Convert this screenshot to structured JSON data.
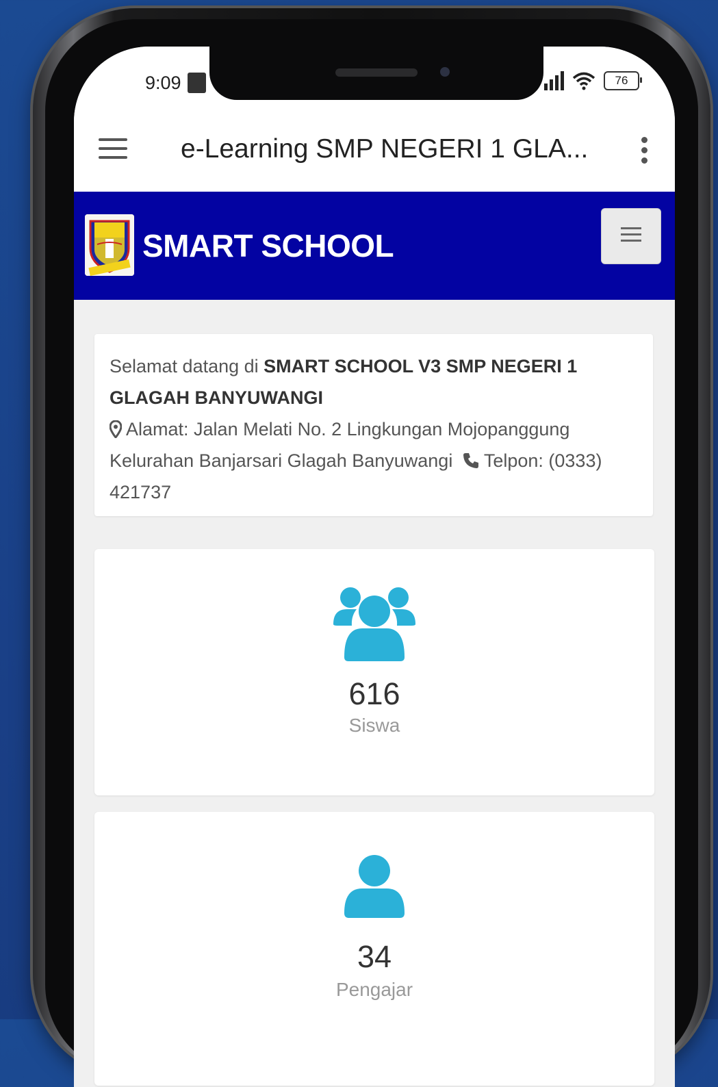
{
  "status_bar": {
    "time": "9:09",
    "battery": "76"
  },
  "app_bar": {
    "title": "e-Learning SMP NEGERI 1 GLA..."
  },
  "header": {
    "brand": "SMART SCHOOL"
  },
  "welcome": {
    "greeting": "Selamat datang di",
    "school_name": "SMART SCHOOL V3 SMP NEGERI 1 GLAGAH BANYUWANGI",
    "address": "Alamat: Jalan Melati No. 2 Lingkungan Mojopanggung Kelurahan Banjarsari Glagah Banyuwangi",
    "phone": "Telpon: (0333) 421737"
  },
  "stats": [
    {
      "value": "616",
      "label": "Siswa",
      "icon": "users-icon"
    },
    {
      "value": "34",
      "label": "Pengajar",
      "icon": "user-icon"
    }
  ],
  "colors": {
    "header_bg": "#0303a2",
    "icon_accent": "#2bb1d8",
    "page_bg": "#1b4a92"
  }
}
